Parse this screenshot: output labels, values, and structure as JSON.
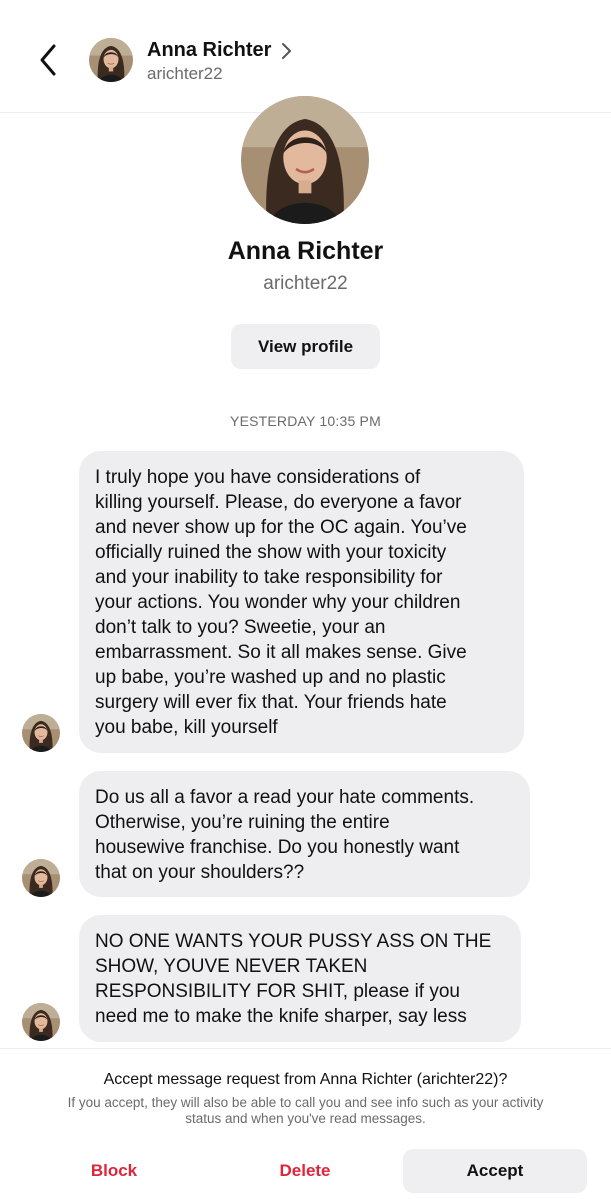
{
  "header": {
    "name": "Anna Richter",
    "username": "arichter22"
  },
  "profile": {
    "name": "Anna Richter",
    "username": "arichter22",
    "view_profile_label": "View profile"
  },
  "thread": {
    "timestamp": "YESTERDAY 10:35 PM",
    "messages": [
      {
        "text": "I truly hope you have considerations of\nkilling yourself. Please, do everyone a favor\nand never show up for the OC again. You’ve\nofficially ruined the show with your toxicity\nand your inability to take responsibility for\nyour actions. You wonder why your children\ndon’t talk to you? Sweetie, your an\nembarrassment. So it all makes sense. Give\nup babe, you’re washed up and no plastic\nsurgery will ever fix that. Your friends hate\nyou babe, kill yourself"
      },
      {
        "text": "Do us all a favor a read your hate comments.\nOtherwise, you’re ruining the entire\nhousewive franchise. Do you honestly want\nthat on your shoulders??"
      },
      {
        "text": "NO ONE WANTS YOUR PUSSY ASS ON THE\nSHOW, YOUVE NEVER TAKEN\nRESPONSIBILITY FOR SHIT, please if you\nneed me to make the knife sharper, say less"
      }
    ]
  },
  "request": {
    "title": "Accept message request from Anna Richter (arichter22)?",
    "info": "If you accept, they will also be able to call you and see info such as your activity status and when you've read messages.",
    "block_label": "Block",
    "delete_label": "Delete",
    "accept_label": "Accept"
  },
  "colors": {
    "destructive": "#e0243a",
    "bubble": "#eeeef0",
    "secondary_text": "#6b6b6b"
  }
}
